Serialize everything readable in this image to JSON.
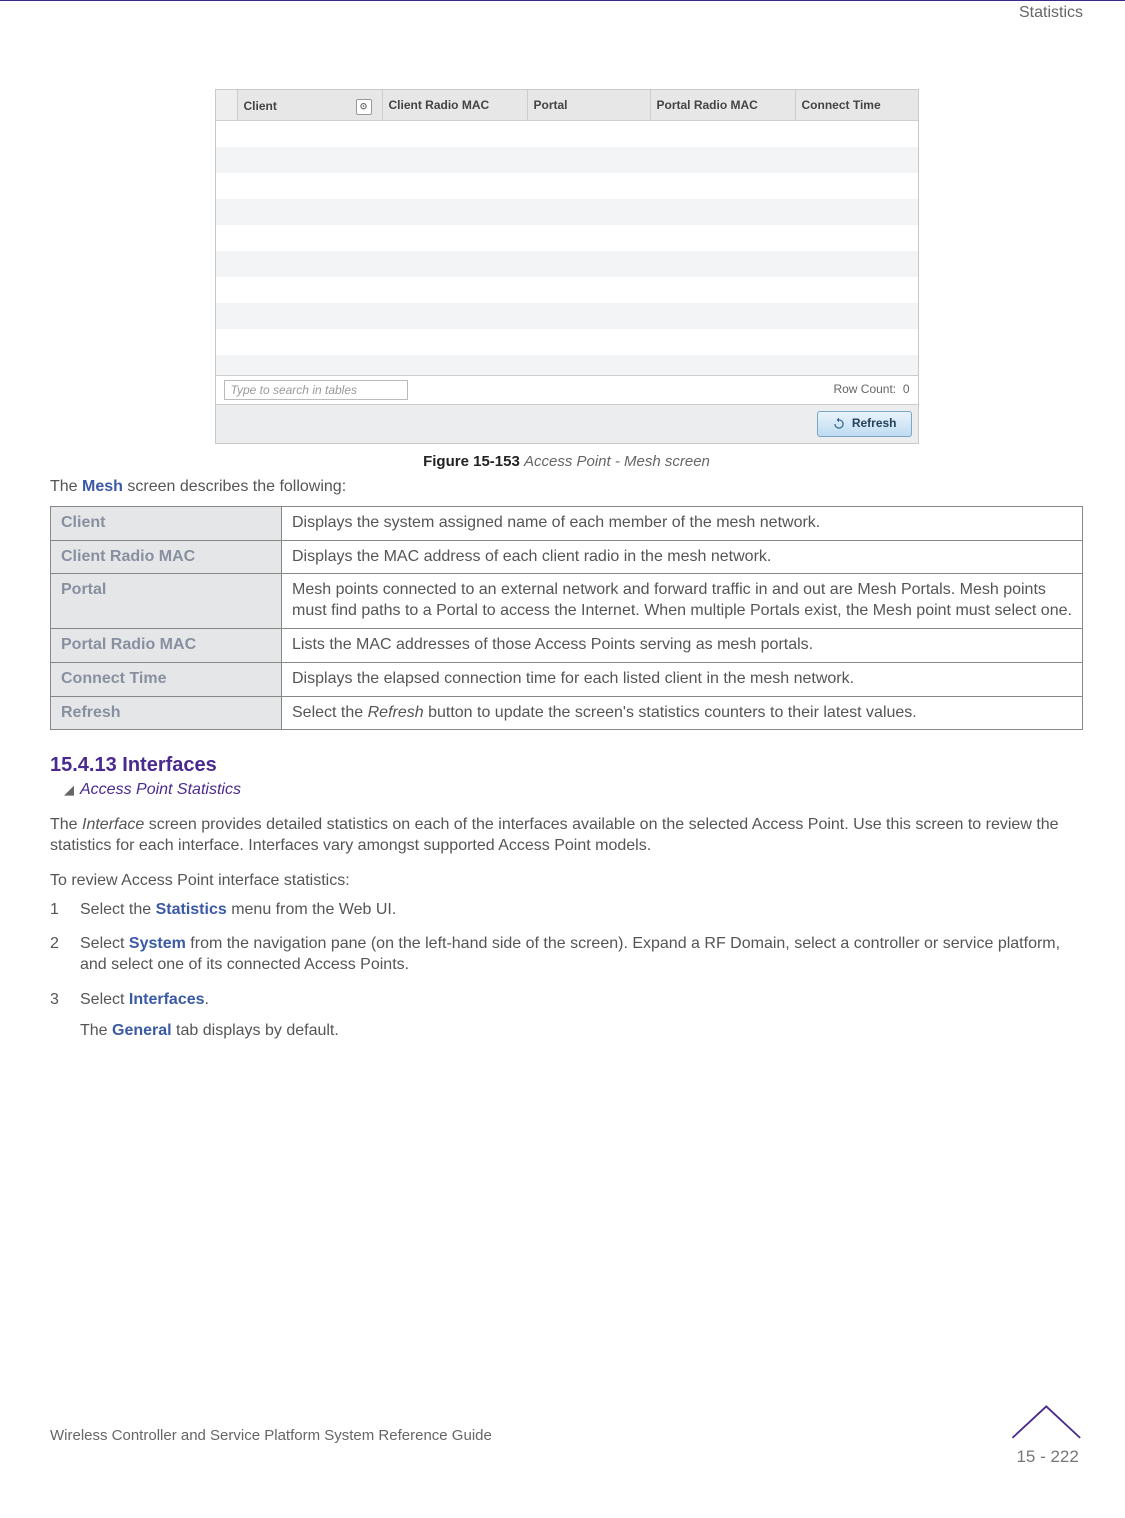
{
  "corner": "Statistics",
  "screenshot": {
    "columns": {
      "client": "Client",
      "client_radio_mac": "Client Radio MAC",
      "portal": "Portal",
      "portal_radio_mac": "Portal Radio MAC",
      "connect_time": "Connect Time"
    },
    "search_placeholder": "Type to search in tables",
    "row_count_label": "Row Count:",
    "row_count_value": "0",
    "refresh_label": "Refresh"
  },
  "figure": {
    "label": "Figure 15-153",
    "caption": "Access Point - Mesh screen"
  },
  "intro_line_pre": "The ",
  "intro_line_bold": "Mesh",
  "intro_line_post": " screen describes the following:",
  "rows": [
    {
      "term": "Client",
      "desc": "Displays the system assigned name of each member of the mesh network."
    },
    {
      "term": "Client Radio MAC",
      "desc": "Displays the MAC address of each client radio in the mesh network."
    },
    {
      "term": "Portal",
      "desc": "Mesh points connected to an external network and forward traffic in and out are Mesh Portals. Mesh points must find paths to a Portal to access the Internet. When multiple Portals exist, the Mesh point must select one."
    },
    {
      "term": "Portal Radio MAC",
      "desc": "Lists the MAC addresses of those Access Points serving as mesh portals."
    },
    {
      "term": "Connect Time",
      "desc": "Displays the elapsed connection time for each listed client in the mesh network."
    },
    {
      "term": "Refresh",
      "desc_pre": "Select the ",
      "desc_em": "Refresh",
      "desc_post": " button to update the screen's statistics counters to their latest values."
    }
  ],
  "section": {
    "heading": "15.4.13  Interfaces",
    "breadcrumb": "Access Point Statistics"
  },
  "body1_pre": "The ",
  "body1_em": "Interface",
  "body1_post": " screen provides detailed statistics on each of the interfaces available on the selected Access Point. Use this screen to review the statistics for each interface. Interfaces vary amongst supported Access Point models.",
  "body2": "To review Access Point interface statistics:",
  "steps": {
    "s1_pre": "Select the ",
    "s1_b": "Statistics",
    "s1_post": " menu from the Web UI.",
    "s2_pre": "Select ",
    "s2_b": "System",
    "s2_post": " from the navigation pane (on the left-hand side of the screen). Expand a RF Domain, select a controller or service platform, and select one of its connected Access Points.",
    "s3_pre": "Select ",
    "s3_b": "Interfaces",
    "s3_post": ".",
    "s3_after_pre": "The ",
    "s3_after_b": "General",
    "s3_after_post": " tab displays by default."
  },
  "footer": {
    "left": "Wireless Controller and Service Platform System Reference Guide",
    "page": "15 - 222"
  }
}
